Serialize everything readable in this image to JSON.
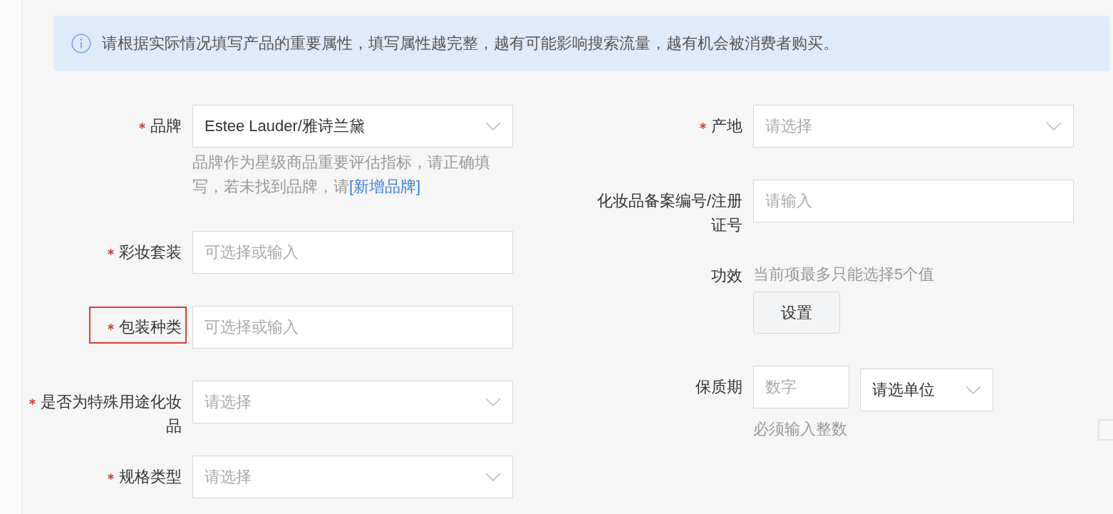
{
  "notice": {
    "text": "请根据实际情况填写产品的重要属性，填写属性越完整，越有可能影响搜索流量，越有机会被消费者购买。"
  },
  "left_fields": [
    {
      "label": "品牌",
      "required": true,
      "highlighted": false,
      "kind": "select",
      "value": "Estee Lauder/雅诗兰黛",
      "hint": "品牌作为星级商品重要评估指标，请正确填写，若未找到品牌，请",
      "hint_link": "[新增品牌]"
    },
    {
      "label": "彩妆套装",
      "required": true,
      "highlighted": false,
      "kind": "input",
      "placeholder": "可选择或输入"
    },
    {
      "label": "包装种类",
      "required": true,
      "highlighted": true,
      "kind": "input",
      "placeholder": "可选择或输入"
    },
    {
      "label": "是否为特殊用途化妆品",
      "required": true,
      "highlighted": false,
      "kind": "select",
      "placeholder": "请选择"
    },
    {
      "label": "规格类型",
      "required": true,
      "highlighted": false,
      "kind": "select",
      "placeholder": "请选择"
    }
  ],
  "right_fields": [
    {
      "label": "产地",
      "required": true,
      "highlighted": false,
      "kind": "select",
      "placeholder": "请选择"
    },
    {
      "label": "化妆品备案编号/注册证号",
      "required": false,
      "highlighted": false,
      "kind": "input",
      "placeholder": "请输入"
    },
    {
      "label": "功效",
      "required": false,
      "highlighted": false,
      "kind": "button",
      "note": "当前项最多只能选择5个值",
      "button": "设置"
    },
    {
      "label": "保质期",
      "required": false,
      "highlighted": false,
      "kind": "number_unit",
      "placeholder": "数字",
      "unit": "请选单位",
      "hint": "必须输入整数"
    }
  ]
}
